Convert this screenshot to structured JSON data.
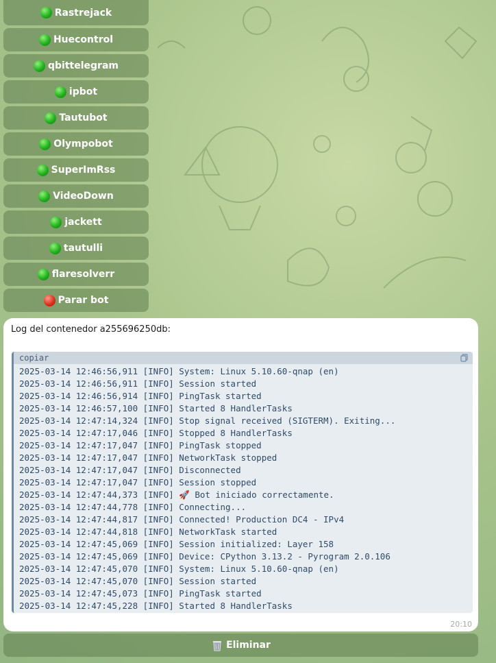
{
  "keyboard": {
    "buttons": [
      {
        "label": "Rastrejack",
        "status": "green"
      },
      {
        "label": "Huecontrol",
        "status": "green"
      },
      {
        "label": "qbittelegram",
        "status": "green"
      },
      {
        "label": "ipbot",
        "status": "green"
      },
      {
        "label": "Tautubot",
        "status": "green"
      },
      {
        "label": "Olympobot",
        "status": "green"
      },
      {
        "label": "SuperImRss",
        "status": "green"
      },
      {
        "label": "VideoDown",
        "status": "green"
      },
      {
        "label": "jackett",
        "status": "green"
      },
      {
        "label": "tautulli",
        "status": "green"
      },
      {
        "label": "flaresolverr",
        "status": "green"
      },
      {
        "label": "Parar bot",
        "status": "red"
      }
    ]
  },
  "message": {
    "title": "Log del contenedor a255696250db:",
    "code_header": "copiar",
    "time": "20:10",
    "lines": [
      "2025-03-14 12:46:56,911 [INFO] System: Linux 5.10.60-qnap (en)",
      "2025-03-14 12:46:56,911 [INFO] Session started",
      "2025-03-14 12:46:56,914 [INFO] PingTask started",
      "2025-03-14 12:46:57,100 [INFO] Started 8 HandlerTasks",
      "2025-03-14 12:47:14,324 [INFO] Stop signal received (SIGTERM). Exiting...",
      "2025-03-14 12:47:17,046 [INFO] Stopped 8 HandlerTasks",
      "2025-03-14 12:47:17,047 [INFO] PingTask stopped",
      "2025-03-14 12:47:17,047 [INFO] NetworkTask stopped",
      "2025-03-14 12:47:17,047 [INFO] Disconnected",
      "2025-03-14 12:47:17,047 [INFO] Session stopped",
      "2025-03-14 12:47:44,373 [INFO] 🚀 Bot iniciado correctamente.",
      "2025-03-14 12:47:44,778 [INFO] Connecting...",
      "2025-03-14 12:47:44,817 [INFO] Connected! Production DC4 - IPv4",
      "2025-03-14 12:47:44,818 [INFO] NetworkTask started",
      "2025-03-14 12:47:45,069 [INFO] Session initialized: Layer 158",
      "2025-03-14 12:47:45,069 [INFO] Device: CPython 3.13.2 - Pyrogram 2.0.106",
      "2025-03-14 12:47:45,070 [INFO] System: Linux 5.10.60-qnap (en)",
      "2025-03-14 12:47:45,070 [INFO] Session started",
      "2025-03-14 12:47:45,073 [INFO] PingTask started",
      "2025-03-14 12:47:45,228 [INFO] Started 8 HandlerTasks"
    ]
  },
  "delete_button": {
    "icon": "wastebasket-icon",
    "label": "Eliminar"
  }
}
